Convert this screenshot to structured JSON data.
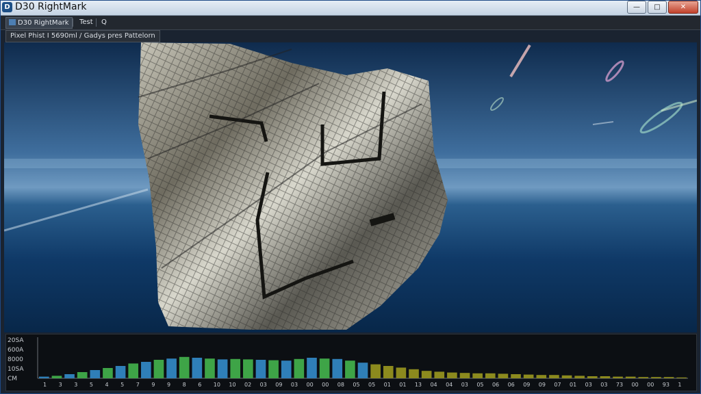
{
  "window": {
    "title": "D30 RightMark",
    "icon": "app-logo-icon",
    "controls": {
      "minimize": "—",
      "maximize": "□",
      "close": "✕"
    }
  },
  "toolbar": {
    "tab_label": "D30 RightMark",
    "test_label": "Test",
    "search_icon": "Q"
  },
  "info": {
    "text": "Pixel Phist I 5690ml / Gadys pres Pattelorn"
  },
  "graph": {
    "y_labels": [
      "20SA",
      "600A",
      "8000",
      "10SA",
      "CM"
    ],
    "x_labels": [
      "1",
      "3",
      "3",
      "5",
      "4",
      "5",
      "7",
      "9",
      "9",
      "8",
      "6",
      "10",
      "10",
      "02",
      "03",
      "09",
      "03",
      "00",
      "00",
      "08",
      "05",
      "05",
      "01",
      "01",
      "13",
      "04",
      "04",
      "03",
      "05",
      "06",
      "06",
      "09",
      "09",
      "07",
      "01",
      "03",
      "03",
      "73",
      "00",
      "00",
      "93",
      "1"
    ],
    "colors": {
      "blue": "#2f7fb8",
      "green": "#3ea447",
      "olive": "#8c8a1e"
    },
    "values": [
      0.04,
      0.06,
      0.1,
      0.15,
      0.2,
      0.25,
      0.3,
      0.36,
      0.4,
      0.45,
      0.48,
      0.52,
      0.5,
      0.48,
      0.46,
      0.47,
      0.46,
      0.45,
      0.44,
      0.43,
      0.47,
      0.5,
      0.48,
      0.47,
      0.43,
      0.38,
      0.34,
      0.3,
      0.26,
      0.22,
      0.18,
      0.16,
      0.14,
      0.13,
      0.12,
      0.12,
      0.11,
      0.1,
      0.09,
      0.08,
      0.08,
      0.07,
      0.06,
      0.05,
      0.05,
      0.04,
      0.04,
      0.03,
      0.03,
      0.03,
      0.02
    ]
  }
}
